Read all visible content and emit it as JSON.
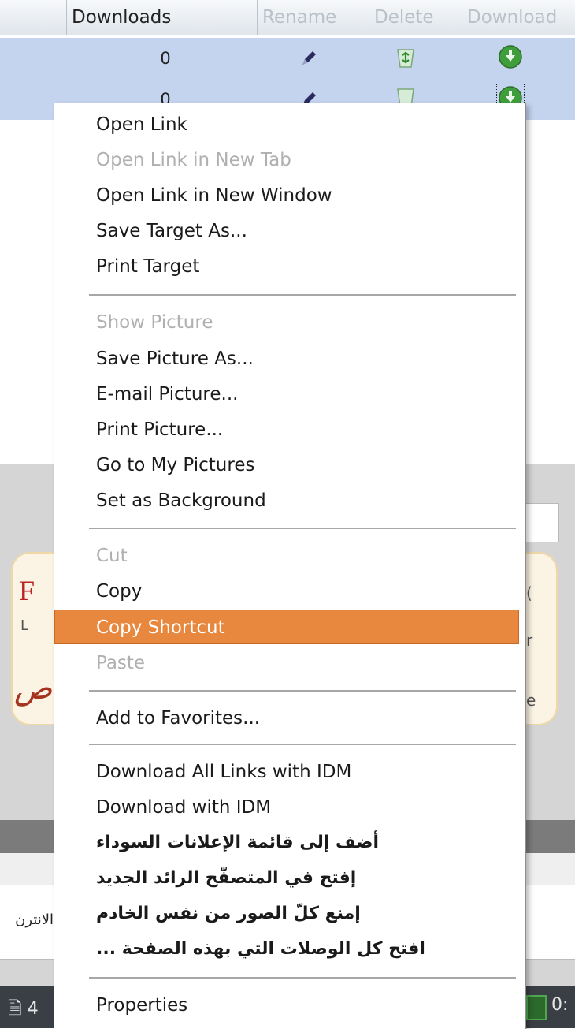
{
  "table": {
    "headers": {
      "downloads": "Downloads",
      "rename": "Rename",
      "delete": "Delete",
      "download": "Download"
    },
    "rows": [
      {
        "downloads": "0"
      },
      {
        "downloads": "0"
      }
    ]
  },
  "background": {
    "letter_f": "F",
    "letter_l": "L",
    "script_glyph": "ص",
    "side_r1": "r",
    "side_e": "e",
    "arabic_partial": "الانترن",
    "taskbar_left": "4",
    "taskbar_right": "0:"
  },
  "menu": {
    "items": [
      {
        "label": "Open Link",
        "enabled": true
      },
      {
        "label": "Open Link in New Tab",
        "enabled": false
      },
      {
        "label": "Open Link in New Window",
        "enabled": true
      },
      {
        "label": "Save Target As...",
        "enabled": true
      },
      {
        "label": "Print Target",
        "enabled": true
      },
      {
        "label": "Show Picture",
        "enabled": false
      },
      {
        "label": "Save Picture As...",
        "enabled": true
      },
      {
        "label": "E-mail Picture...",
        "enabled": true
      },
      {
        "label": "Print Picture...",
        "enabled": true
      },
      {
        "label": "Go to My Pictures",
        "enabled": true
      },
      {
        "label": "Set as Background",
        "enabled": true
      },
      {
        "label": "Cut",
        "enabled": false
      },
      {
        "label": "Copy",
        "enabled": true
      },
      {
        "label": "Copy Shortcut",
        "enabled": true,
        "highlighted": true
      },
      {
        "label": "Paste",
        "enabled": false
      },
      {
        "label": "Add to Favorites...",
        "enabled": true
      },
      {
        "label": "Download All Links with IDM",
        "enabled": true
      },
      {
        "label": "Download with IDM",
        "enabled": true
      },
      {
        "label": "أضف إلى قائمة الإعلانات السوداء",
        "enabled": true
      },
      {
        "label": "إفتح في المتصفّح الرائد الجديد",
        "enabled": true
      },
      {
        "label": "إمنع كلّ الصور من نفس الخادم",
        "enabled": true
      },
      {
        "label": "... افتح كل الوصلات التي بهذه الصفحة",
        "enabled": true
      },
      {
        "label": "Properties",
        "enabled": true
      }
    ]
  },
  "colors": {
    "selection_row": "#c4d3ee",
    "menu_highlight": "#e8873e",
    "disabled_text": "#b0b0b0"
  },
  "icons": [
    "pencil-icon",
    "recycle-bin-icon",
    "green-download-arrow-icon"
  ]
}
